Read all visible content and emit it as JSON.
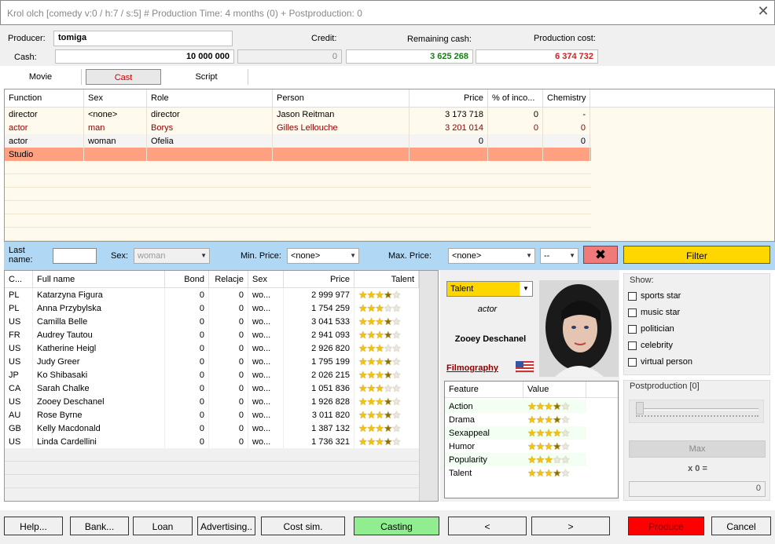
{
  "window": {
    "title": "Krol olch [comedy v:0 / h:7 / s:5] # Production Time: 4  months (0) + Postproduction: 0",
    "close_glyph": "✕"
  },
  "top": {
    "producer_label": "Producer:",
    "producer_value": "tomiga",
    "cash_label": "Cash:",
    "cash_value": "10 000 000",
    "credit_label": "Credit:",
    "credit_value": "0",
    "remaining_label": "Remaining cash:",
    "remaining_value": "3 625 268",
    "production_label": "Production cost:",
    "production_value": "6 374 732",
    "colors": {
      "remaining": "#1a7a1a",
      "production": "#cc2222"
    }
  },
  "tabs": [
    {
      "label": "Movie"
    },
    {
      "label": "Cast"
    },
    {
      "label": "Script"
    }
  ],
  "cast_table": {
    "headers": [
      "Function",
      "Sex",
      "Role",
      "Person",
      "Price",
      "% of inco...",
      "Chemistry"
    ],
    "rows": [
      {
        "function": "director",
        "sex": "<none>",
        "role": "director",
        "person": "Jason Reitman",
        "price": "3 173 718",
        "pct": "0",
        "chem": "-"
      },
      {
        "function": "actor",
        "sex": "man",
        "role": "Borys",
        "person": "Gilles Lellouche",
        "price": "3 201 014",
        "pct": "0",
        "chem": "0"
      },
      {
        "function": "actor",
        "sex": "woman",
        "role": "Ofelia",
        "person": "",
        "price": "0",
        "pct": "",
        "chem": "0"
      },
      {
        "function": "Studio",
        "sex": "",
        "role": "",
        "person": "",
        "price": "",
        "pct": "",
        "chem": ""
      }
    ]
  },
  "filter": {
    "last_name_label": "Last\nname:",
    "last_name_value": "",
    "sex_label": "Sex:",
    "sex_value": "woman",
    "min_price_label": "Min. Price:",
    "min_price_value": "<none>",
    "max_price_label": "Max. Price:",
    "max_price_value": "<none>",
    "extra_value": "--",
    "clear_glyph": "✖",
    "filter_label": "Filter"
  },
  "actors": {
    "headers": [
      "C...",
      "Full name",
      "Bond",
      "Relacje",
      "Sex",
      "Price",
      "Talent"
    ],
    "rows": [
      {
        "c": "PL",
        "name": "Katarzyna Figura",
        "bond": "0",
        "rel": "0",
        "sex": "wo...",
        "price": "2 999 977",
        "talent": 3.5
      },
      {
        "c": "PL",
        "name": "Anna Przybylska",
        "bond": "0",
        "rel": "0",
        "sex": "wo...",
        "price": "1 754 259",
        "talent": 3
      },
      {
        "c": "US",
        "name": "Camilla Belle",
        "bond": "0",
        "rel": "0",
        "sex": "wo...",
        "price": "3 041 533",
        "talent": 3.5
      },
      {
        "c": "FR",
        "name": "Audrey Tautou",
        "bond": "0",
        "rel": "0",
        "sex": "wo...",
        "price": "2 941 093",
        "talent": 3.5
      },
      {
        "c": "US",
        "name": "Katherine Heigl",
        "bond": "0",
        "rel": "0",
        "sex": "wo...",
        "price": "2 926 820",
        "talent": 3
      },
      {
        "c": "US",
        "name": "Judy Greer",
        "bond": "0",
        "rel": "0",
        "sex": "wo...",
        "price": "1 795 199",
        "talent": 3.5
      },
      {
        "c": "JP",
        "name": "Ko Shibasaki",
        "bond": "0",
        "rel": "0",
        "sex": "wo...",
        "price": "2 026 215",
        "talent": 3.5
      },
      {
        "c": "CA",
        "name": "Sarah Chalke",
        "bond": "0",
        "rel": "0",
        "sex": "wo...",
        "price": "1 051 836",
        "talent": 3
      },
      {
        "c": "US",
        "name": "Zooey Deschanel",
        "bond": "0",
        "rel": "0",
        "sex": "wo...",
        "price": "1 926 828",
        "talent": 3.5
      },
      {
        "c": "AU",
        "name": "Rose Byrne",
        "bond": "0",
        "rel": "0",
        "sex": "wo...",
        "price": "3 011 820",
        "talent": 3.5
      },
      {
        "c": "GB",
        "name": "Kelly Macdonald",
        "bond": "0",
        "rel": "0",
        "sex": "wo...",
        "price": "1 387 132",
        "talent": 3.5
      },
      {
        "c": "US",
        "name": "Linda Cardellini",
        "bond": "0",
        "rel": "0",
        "sex": "wo...",
        "price": "1 736 321",
        "talent": 3.5
      }
    ]
  },
  "detail": {
    "sort_value": "Talent",
    "role": "actor",
    "name": "Zooey Deschanel",
    "filmography": "Filmography",
    "feature_header": "Feature",
    "value_header": "Value",
    "features": [
      {
        "name": "Action",
        "stars": 3.5
      },
      {
        "name": "Drama",
        "stars": 3.5
      },
      {
        "name": "Sexappeal",
        "stars": 4
      },
      {
        "name": "Humor",
        "stars": 3.5
      },
      {
        "name": "Popularity",
        "stars": 3
      },
      {
        "name": "Talent",
        "stars": 3.5
      }
    ]
  },
  "show": {
    "title": "Show:",
    "items": [
      "sports star",
      "music star",
      "politician",
      "celebrity",
      "virtual person"
    ]
  },
  "post": {
    "title": "Postproduction [0]",
    "max_label": "Max",
    "mult": "x 0 =",
    "total": "0"
  },
  "buttons": {
    "help": "Help...",
    "bank": "Bank...",
    "loan": "Loan",
    "advertising": "Advertising..",
    "costsim": "Cost sim.",
    "casting": "Casting",
    "prev": "<",
    "next": ">",
    "produce": "Produce",
    "cancel": "Cancel",
    "colors": {
      "casting": "#90ee90",
      "produce": "#ff0000"
    }
  }
}
